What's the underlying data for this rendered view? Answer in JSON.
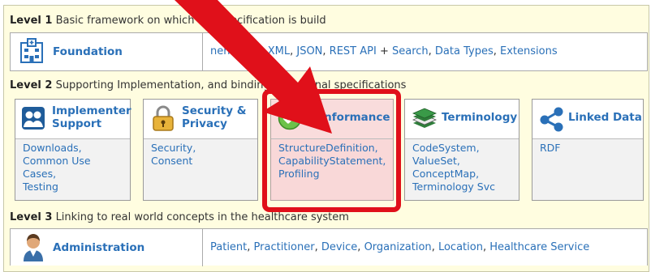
{
  "level1": {
    "label": "Level 1",
    "description": "Basic framework on which the specification is build",
    "box_title": "Foundation",
    "items": [
      "Documentation",
      "XML",
      "JSON",
      "REST API",
      "Search",
      "Data Types",
      "Extensions"
    ],
    "item_visible_prefix": "nentation",
    "sep_comma": ", ",
    "sep_plus": " + "
  },
  "level2": {
    "label": "Level 2",
    "description": "Supporting Implementation, and binding to external specifications",
    "cards": [
      {
        "title_line1": "Implementer",
        "title_line2": "Support",
        "items": [
          "Downloads,",
          "Common Use",
          "Cases,",
          "Testing"
        ]
      },
      {
        "title_line1": "Security &",
        "title_line2": "Privacy",
        "items": [
          "Security,",
          "Consent"
        ]
      },
      {
        "title_line1": "Conformance",
        "title_line2": "",
        "items": [
          "StructureDefinition,",
          "CapabilityStatement,",
          "Profiling"
        ]
      },
      {
        "title_line1": "Terminology",
        "title_line2": "",
        "items": [
          "CodeSystem,",
          "ValueSet,",
          "ConceptMap,",
          "Terminology Svc"
        ]
      },
      {
        "title_line1": "Linked Data",
        "title_line2": "",
        "items": [
          "RDF"
        ]
      }
    ]
  },
  "level3": {
    "label": "Level 3",
    "description": "Linking to real world concepts in the healthcare system",
    "box_title": "Administration",
    "items": [
      "Patient",
      "Practitioner",
      "Device",
      "Organization",
      "Location",
      "Healthcare Service"
    ]
  },
  "colors": {
    "link": "#2a70b8",
    "highlight_border": "#e0101a",
    "arrow": "#e0101a",
    "highlight_fill": "#f9d8d8",
    "frame_bg": "#fffde0"
  }
}
